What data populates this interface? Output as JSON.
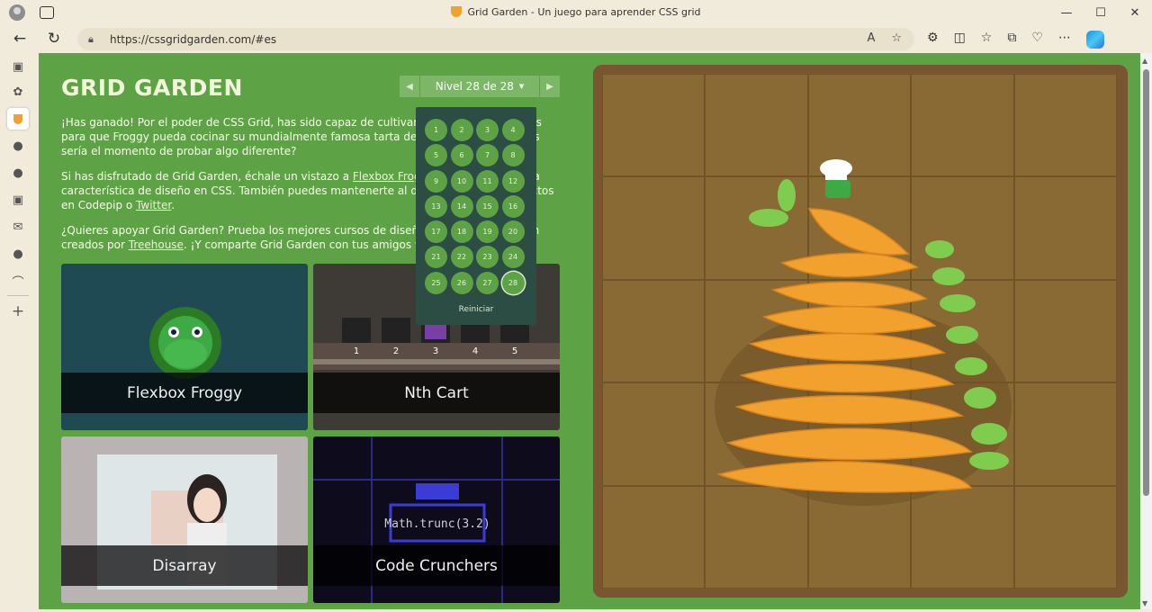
{
  "window": {
    "title": "Grid Garden - Un juego para aprender CSS grid",
    "minimize": "—",
    "maximize": "☐",
    "close": "✕"
  },
  "address": {
    "url": "https://cssgridgarden.com/#es"
  },
  "page": {
    "logo": "GRID GARDEN",
    "level_selector": {
      "label": "Nivel 28 de 28",
      "prev": "◀",
      "next": "▶"
    },
    "intro": {
      "p1": "¡Has ganado! Por el poder de CSS Grid, has sido capaz de cultivar suficientes zanahorias para que Froggy pueda cocinar su mundialmente famosa tarta de 20 zanahorias. Quizás sería el momento de probar algo diferente?",
      "p2_before": "Si has disfrutado de Grid Garden, échale un vistazo a ",
      "p2_link1": "Flexbox Froggy",
      "p2_mid": " para aprender otra característica de diseño en CSS. También puedes mantenerte al día de mis otros proyectos en Codepip o ",
      "p2_link2": "Twitter",
      "p2_after": ".",
      "p3_before": "¿Quieres apoyar Grid Garden? Prueba los mejores cursos de diseño web y programación creados por ",
      "p3_link": "Treehouse",
      "p3_after": ". ¡Y comparte Grid Garden con tus amigos y familia!"
    },
    "levels": [
      "1",
      "2",
      "3",
      "4",
      "5",
      "6",
      "7",
      "8",
      "9",
      "10",
      "11",
      "12",
      "13",
      "14",
      "15",
      "16",
      "17",
      "18",
      "19",
      "20",
      "21",
      "22",
      "23",
      "24",
      "25",
      "26",
      "27",
      "28"
    ],
    "current_level": "28",
    "reset_label": "Reiniciar",
    "cards": [
      {
        "label": "Flexbox Froggy"
      },
      {
        "label": "Nth Cart"
      },
      {
        "label": "Disarray"
      },
      {
        "label": "Code Crunchers"
      }
    ],
    "cart_numbers": [
      "1",
      "2",
      "3",
      "4",
      "5"
    ],
    "code_crunchers_code": "Math.trunc(3.2)"
  },
  "colors": {
    "page_bg": "#5da345",
    "carrot": "#f2a12e",
    "soil": "#8a6a34"
  }
}
